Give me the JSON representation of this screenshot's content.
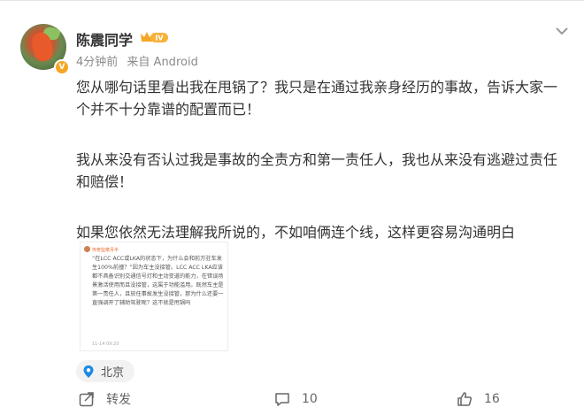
{
  "post": {
    "username": "陈震同学",
    "level_badge": "IV",
    "verified_badge": "V",
    "time": "4分钟前",
    "source": "来自 Android",
    "paragraphs": [
      "您从哪句话里看出我在甩锅了？我只是在通过我亲身经历的事故，告诉大家一个并不十分靠谱的配置而已！",
      "我从来没有否认过我是事故的全责方和第一责任人，我也从来没有逃避过责任和赔偿！",
      "如果您依然无法理解我所说的，不如咱俩连个线，这样更容易沟通明白"
    ],
    "image": {
      "author": "传奇监菜月半",
      "text": "“在LCC ACC或LKA的状态下，为什么会和前方驻车发生100%前撞？”因为车主没接管。LCC ACC LKA应该都不具备识别交通信号灯和主动变道的能力，在错误场景激活使用而且没接管，这属于功能滥用。既然车主是第一责任人，且放任事故发生没接管，那为什么还要一直强调开了辅助驾驶呢？这不就是甩锅吗",
      "time": "11-14 09:20"
    },
    "location": "北京"
  },
  "actions": {
    "share_label": "转发",
    "comment_count": "10",
    "like_count": "16"
  },
  "colors": {
    "accent": "#1e88e5",
    "badge_gold": "#f5a623",
    "text_primary": "#333333",
    "text_secondary": "#8a8a8a"
  }
}
